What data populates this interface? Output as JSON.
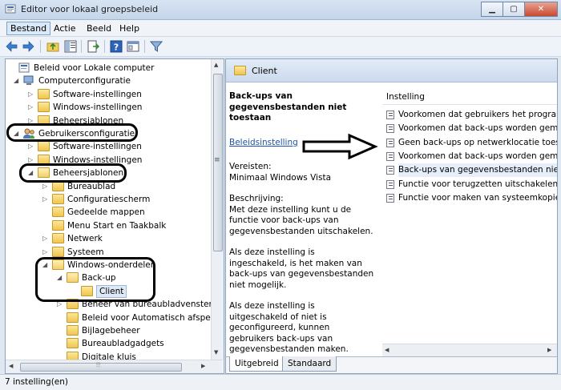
{
  "window": {
    "title": "Editor voor lokaal groepsbeleid",
    "min_glyph": "▁",
    "max_glyph": "▢",
    "close_glyph": "✕"
  },
  "menu": [
    "Bestand",
    "Actie",
    "Beeld",
    "Help"
  ],
  "toolbar_icons": [
    "back-arrow-icon",
    "forward-arrow-icon",
    "up-folder-icon",
    "show-hide-tree-icon",
    "export-list-icon",
    "help-icon",
    "properties-icon",
    "filter-icon"
  ],
  "tree": [
    {
      "label": "Beleid voor Lokale computer",
      "indent": 0,
      "icon": "policy",
      "expander": ""
    },
    {
      "label": "Computerconfiguratie",
      "indent": 1,
      "icon": "computer",
      "expander": "◢"
    },
    {
      "label": "Software-instellingen",
      "indent": 2,
      "icon": "folder",
      "expander": "▷"
    },
    {
      "label": "Windows-instellingen",
      "indent": 2,
      "icon": "folder",
      "expander": "▷"
    },
    {
      "label": "Beheersjablonen",
      "indent": 2,
      "icon": "folder",
      "expander": "▷"
    },
    {
      "label": "Gebruikersconfiguratie",
      "indent": 1,
      "icon": "user",
      "expander": "◢"
    },
    {
      "label": "Software-instellingen",
      "indent": 2,
      "icon": "folder",
      "expander": "▷"
    },
    {
      "label": "Windows-instellingen",
      "indent": 2,
      "icon": "folder",
      "expander": "▷"
    },
    {
      "label": "Beheersjablonen",
      "indent": 2,
      "icon": "folder-open",
      "expander": "◢"
    },
    {
      "label": "Bureaublad",
      "indent": 3,
      "icon": "folder",
      "expander": "▷"
    },
    {
      "label": "Configuratiescherm",
      "indent": 3,
      "icon": "folder",
      "expander": "▷"
    },
    {
      "label": "Gedeelde mappen",
      "indent": 3,
      "icon": "folder",
      "expander": ""
    },
    {
      "label": "Menu Start en Taakbalk",
      "indent": 3,
      "icon": "folder",
      "expander": ""
    },
    {
      "label": "Netwerk",
      "indent": 3,
      "icon": "folder",
      "expander": "▷"
    },
    {
      "label": "Systeem",
      "indent": 3,
      "icon": "folder",
      "expander": "▷"
    },
    {
      "label": "Windows-onderdelen",
      "indent": 3,
      "icon": "folder-open",
      "expander": "◢"
    },
    {
      "label": "Back-up",
      "indent": 4,
      "icon": "folder-open",
      "expander": "◢"
    },
    {
      "label": "Client",
      "indent": 5,
      "icon": "folder",
      "expander": "",
      "selected": true
    },
    {
      "label": "Beheer van bureaubladvensters",
      "indent": 4,
      "icon": "folder",
      "expander": "▷"
    },
    {
      "label": "Beleid voor Automatisch afspelen",
      "indent": 4,
      "icon": "folder",
      "expander": ""
    },
    {
      "label": "Bijlagebeheer",
      "indent": 4,
      "icon": "folder",
      "expander": ""
    },
    {
      "label": "Bureaubladgadgets",
      "indent": 4,
      "icon": "folder",
      "expander": ""
    },
    {
      "label": "Digitale kluis",
      "indent": 4,
      "icon": "folder",
      "expander": ""
    }
  ],
  "right_header": "Client",
  "description": {
    "heading": "Back-ups van gegevensbestanden niet toestaan",
    "link": "Beleidsinstelling",
    "requirements_label": "Vereisten:",
    "requirements_value": "Minimaal Windows Vista",
    "description_label": "Beschrijving:",
    "para1": "Met deze instelling kunt u de functie voor back-ups van gegevensbestanden uitschakelen.",
    "para2": "Als deze instelling is ingeschakeld, is het maken van back-ups van gegevensbestanden niet mogelijk.",
    "para3": "Als deze instelling is uitgeschakeld of niet is geconfigureerd, kunnen gebruikers back-ups van gegevensbestanden maken."
  },
  "list": {
    "column": "Instelling",
    "items": [
      "Voorkomen dat gebruikers het programma",
      "Voorkomen dat back-ups worden gemaakt",
      "Geen back-ups op netwerklocatie toestaan",
      "Voorkomen dat back-ups worden gemaakt",
      "Back-ups van gegevensbestanden niet toestaan",
      "Functie voor terugzetten uitschakelen",
      "Functie voor maken van systeemkopie uitschakelen"
    ],
    "selected_index": 4
  },
  "tabs": [
    "Uitgebreid",
    "Standaard"
  ],
  "status": "7 instelling(en)",
  "scroll_glyphs": {
    "up": "▲",
    "down": "▼",
    "left": "◀",
    "right": "▶",
    "grip": "≡",
    "hgrip": "⦙⦙⦙"
  }
}
